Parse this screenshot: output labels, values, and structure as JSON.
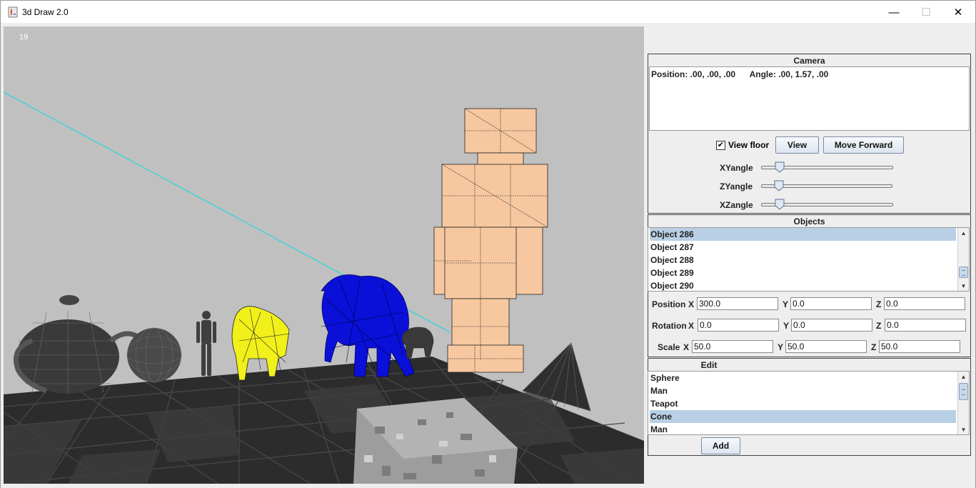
{
  "window": {
    "title": "3d Draw 2.0",
    "minimize_glyph": "—",
    "maximize_glyph": "☐",
    "close_glyph": "✕"
  },
  "viewport": {
    "fps": "19",
    "background_color": "#c0c0c0",
    "objects_drawn": [
      "teapot",
      "sphere",
      "man",
      "yellow-bear",
      "blue-elephant",
      "small-animal",
      "tall-robot",
      "cone",
      "stone-cube",
      "floor-grid",
      "cyan-line"
    ]
  },
  "camera": {
    "title": "Camera",
    "info": "Position: .00, .00, .00      Angle: .00, 1.57, .00",
    "view_floor_label": "View floor",
    "view_floor_checked": true,
    "view_button": "View",
    "move_forward_button": "Move Forward",
    "sliders": [
      {
        "label": "XYangle",
        "value": 0.1
      },
      {
        "label": "ZYangle",
        "value": 0.1
      },
      {
        "label": "XZangle",
        "value": 0.1
      }
    ]
  },
  "objects": {
    "title": "Objects",
    "items": [
      "Object 286",
      "Object 287",
      "Object 288",
      "Object 289",
      "Object 290"
    ],
    "selected": "Object 286",
    "position": {
      "label": "Position",
      "x_label": "X",
      "x": "300.0",
      "y_label": "Y",
      "y": "0.0",
      "z_label": "Z",
      "z": "0.0"
    },
    "rotation": {
      "label": "Rotation",
      "x_label": "X",
      "x": "0.0",
      "y_label": "Y",
      "y": "0.0",
      "z_label": "Z",
      "z": "0.0"
    },
    "scale": {
      "label": "Scale",
      "x_label": "X",
      "x": "50.0",
      "y_label": "Y",
      "y": "50.0",
      "z_label": "Z",
      "z": "50.0"
    }
  },
  "edit": {
    "title": "Edit",
    "items": [
      "Sphere",
      "Man",
      "Teapot",
      "Cone",
      "Man"
    ],
    "selected_index": 3,
    "add_button": "Add"
  },
  "colors": {
    "selection": "#b8cfe5",
    "robot": "#f7c8a0",
    "elephant": "#0a10d8",
    "bear": "#f2f01a",
    "floor_dark": "#2b2b2b",
    "line": "#34d6d6"
  }
}
